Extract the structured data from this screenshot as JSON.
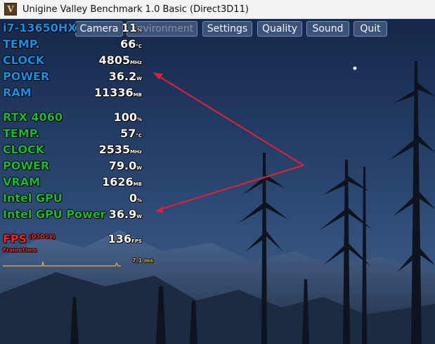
{
  "window": {
    "title": "Unigine Valley Benchmark 1.0 Basic (Direct3D11)",
    "icon": "valley-logo-icon"
  },
  "menu": {
    "items": [
      {
        "label": "Camera"
      },
      {
        "label": "Environment"
      },
      {
        "label": "Settings"
      },
      {
        "label": "Quality"
      },
      {
        "label": "Sound"
      },
      {
        "label": "Quit"
      }
    ]
  },
  "osd": {
    "cpu": {
      "name": "i7-13650HX",
      "load": "11",
      "load_unit": "%",
      "temp_label": "TEMP.",
      "temp": "66",
      "temp_unit": "°C",
      "clock_label": "CLOCK",
      "clock": "4805",
      "clock_unit": "MHz",
      "power_label": "POWER",
      "power": "36.2",
      "power_unit": "W",
      "ram_label": "RAM",
      "ram": "11336",
      "ram_unit": "MB"
    },
    "gpu": {
      "name": "RTX 4060",
      "load": "100",
      "load_unit": "%",
      "temp_label": "TEMP.",
      "temp": "57",
      "temp_unit": "°C",
      "clock_label": "CLOCK",
      "clock": "2535",
      "clock_unit": "MHz",
      "power_label": "POWER",
      "power": "79.0",
      "power_unit": "W",
      "vram_label": "VRAM",
      "vram": "1626",
      "vram_unit": "MB"
    },
    "igpu": {
      "name": "Intel GPU",
      "load": "0",
      "load_unit": "%",
      "power_label": "Intel GPU Power",
      "power": "36.9",
      "power_unit": "W"
    },
    "fps": {
      "label": "FPS",
      "api": "(D3D11)",
      "value": "136",
      "unit": "FPS",
      "frametime_label": "Frametime",
      "frametime_value": "7.1 ms"
    }
  },
  "colors": {
    "cpu": "#1a8fe4",
    "gpu": "#21b43a",
    "fps": "#ff2323",
    "annotation": "#e0203a"
  }
}
